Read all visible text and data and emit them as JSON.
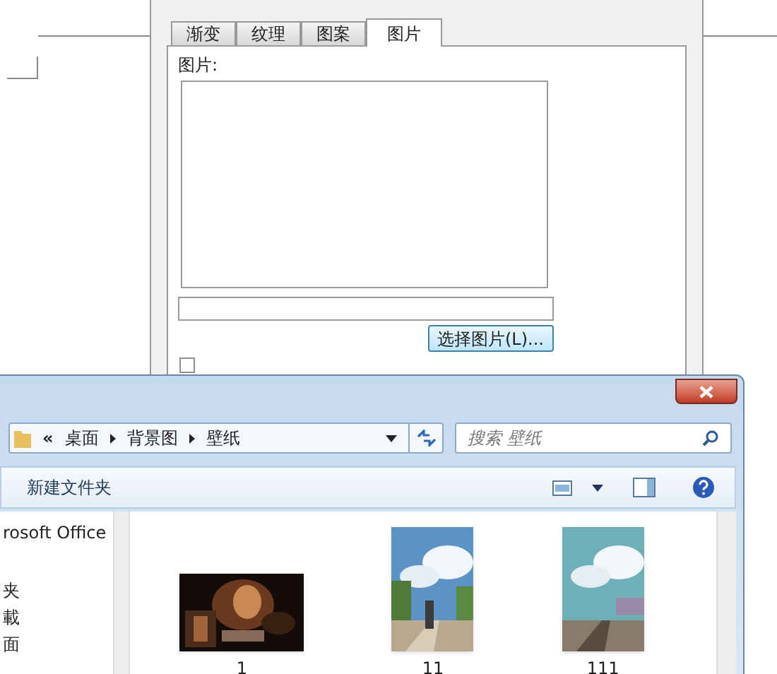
{
  "fill_dialog": {
    "tabs": [
      {
        "label": "渐变",
        "selected": false
      },
      {
        "label": "纹理",
        "selected": false
      },
      {
        "label": "图案",
        "selected": false
      },
      {
        "label": "图片",
        "selected": true
      }
    ],
    "picture_label": "图片:",
    "select_button": "选择图片(L)...",
    "lock_checkbox": {
      "checked": false
    }
  },
  "file_dialog": {
    "back_marker": "«",
    "path": [
      "桌面",
      "背景图",
      "壁纸"
    ],
    "search": {
      "placeholder": "搜索 壁纸"
    },
    "new_folder": "新建文件夹",
    "nav_items": [
      "rosoft Office",
      "夹",
      "載",
      "面"
    ],
    "files": [
      {
        "name": "1",
        "kind": "picture"
      },
      {
        "name": "11",
        "kind": "picture"
      },
      {
        "name": "111",
        "kind": "picture"
      }
    ]
  }
}
